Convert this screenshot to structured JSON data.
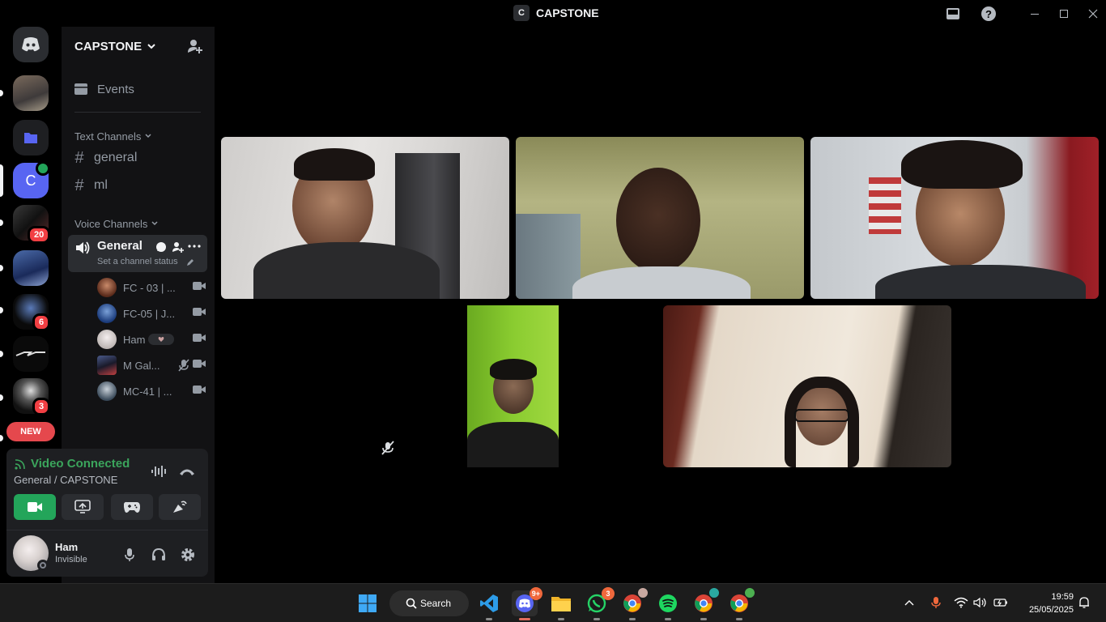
{
  "window": {
    "title": "CAPSTONE",
    "title_badge": "C"
  },
  "rail": {
    "badges": {
      "server4": "20",
      "server6": "6",
      "server8": "3"
    },
    "new_label": "NEW"
  },
  "guild": {
    "name": "CAPSTONE",
    "events_label": "Events",
    "text_category": "Text Channels",
    "text_channels": [
      "general",
      "ml"
    ],
    "voice_category": "Voice Channels",
    "voice_channel": {
      "name": "General",
      "status_placeholder": "Set a channel status"
    },
    "members": [
      {
        "name": "FC - 03 | ..."
      },
      {
        "name": "FC-05 | J..."
      },
      {
        "name": "Ham"
      },
      {
        "name": "M Gal..."
      },
      {
        "name": "MC-41 | ..."
      }
    ]
  },
  "voice_panel": {
    "status": "Video Connected",
    "location": "General / CAPSTONE"
  },
  "user": {
    "name": "Ham",
    "status": "Invisible"
  },
  "taskbar": {
    "search_label": "Search",
    "discord_badge": "9+",
    "whatsapp_badge": "3",
    "time": "19:59",
    "date": "25/05/2025"
  },
  "colors": {
    "accent_green": "#3ba55c",
    "discord_blurple": "#5865f2",
    "badge_red": "#f23f43"
  }
}
